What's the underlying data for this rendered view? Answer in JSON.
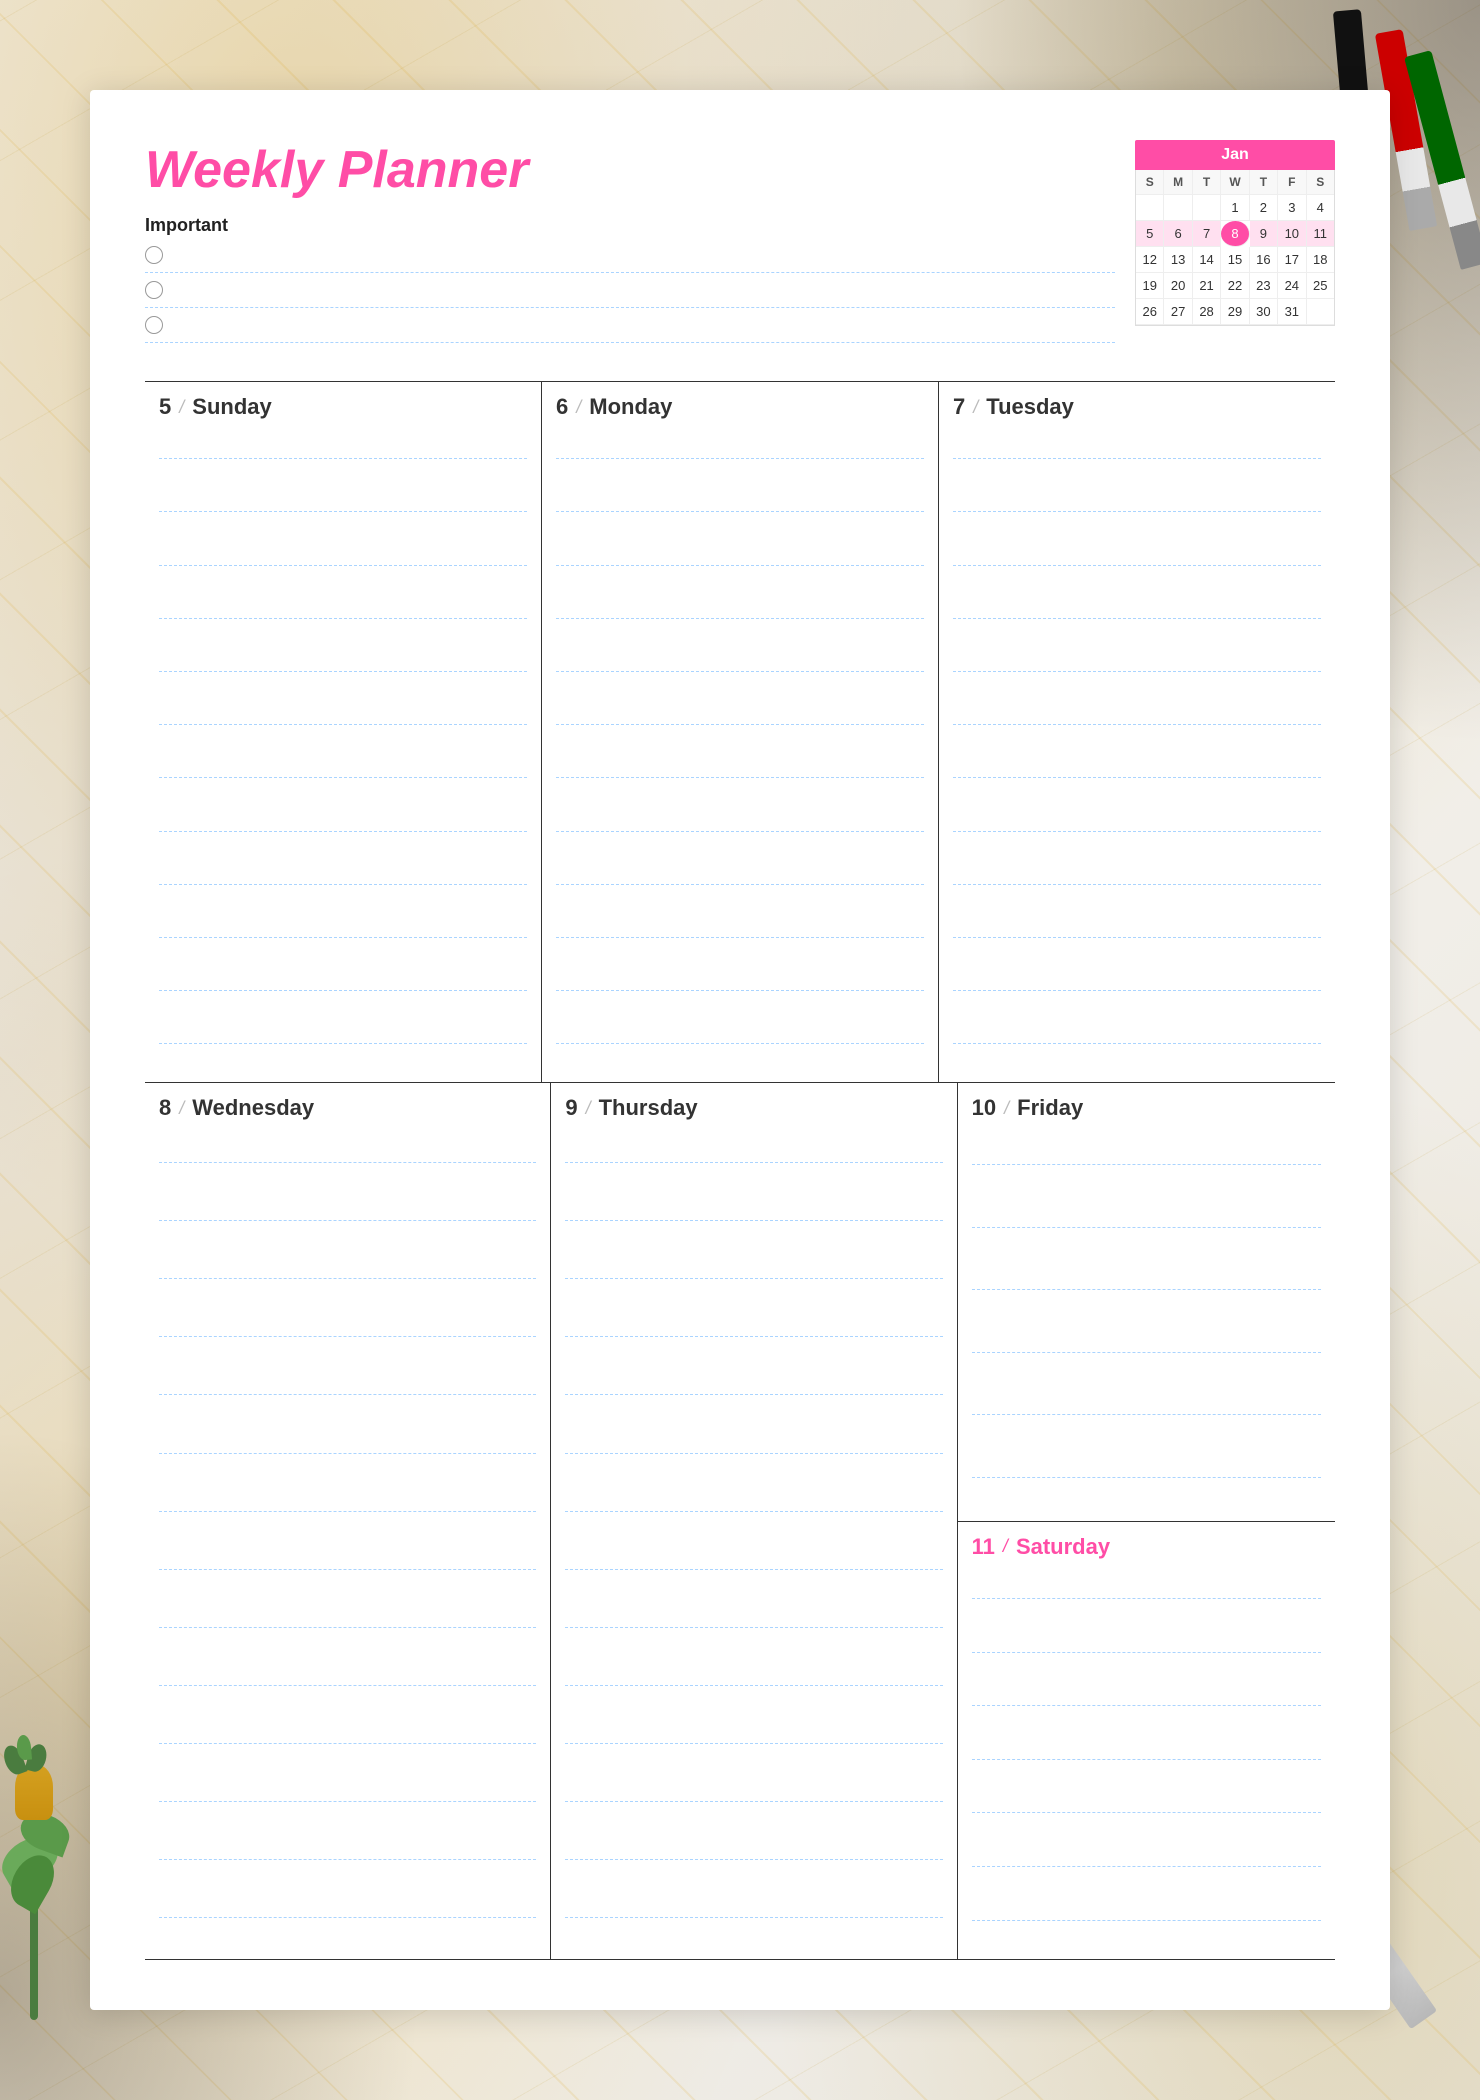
{
  "page": {
    "title": "Weekly Planner"
  },
  "header": {
    "title": "Weekly Planner",
    "important_label": "Important"
  },
  "calendar": {
    "month": "Jan",
    "days_header": [
      "S",
      "M",
      "T",
      "W",
      "T",
      "F",
      "S"
    ],
    "weeks": [
      [
        "",
        "",
        "",
        "1",
        "2",
        "3",
        "4"
      ],
      [
        "5",
        "6",
        "7",
        "8",
        "9",
        "10",
        "11"
      ],
      [
        "12",
        "13",
        "14",
        "15",
        "16",
        "17",
        "18"
      ],
      [
        "19",
        "20",
        "21",
        "22",
        "23",
        "24",
        "25"
      ],
      [
        "26",
        "27",
        "28",
        "29",
        "30",
        "31",
        ""
      ]
    ]
  },
  "days_row1": [
    {
      "number": "5",
      "name": "Sunday",
      "highlight": false
    },
    {
      "number": "6",
      "name": "Monday",
      "highlight": false
    },
    {
      "number": "7",
      "name": "Tuesday",
      "highlight": false
    }
  ],
  "days_row2": [
    {
      "number": "8",
      "name": "Wednesday",
      "highlight": false
    },
    {
      "number": "9",
      "name": "Thursday",
      "highlight": false
    }
  ],
  "friday": {
    "number": "10",
    "name": "Friday",
    "highlight": false
  },
  "saturday": {
    "number": "11",
    "name": "Saturday",
    "highlight": true
  },
  "lines_per_day": 12,
  "separator": "/"
}
